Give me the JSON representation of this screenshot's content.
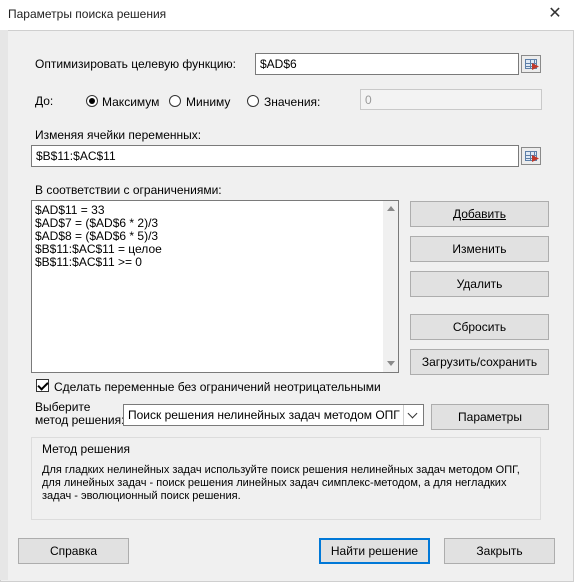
{
  "window": {
    "title": "Параметры поиска решения",
    "close_glyph": "✕"
  },
  "objective": {
    "label": "Оптимизировать целевую функцию:",
    "value": "$AD$6"
  },
  "goal": {
    "label": "До:",
    "options": [
      "Максимум",
      "Миниму",
      "Значения:"
    ],
    "selected": "Максимум",
    "value_field": "0"
  },
  "variables": {
    "label": "Изменяя ячейки переменных:",
    "value": "$B$11:$AC$11"
  },
  "constraints": {
    "label": "В соответствии с ограничениями:",
    "items": [
      "$AD$11 = 33",
      "$AD$7 = ($AD$6 * 2)/3",
      "$AD$8 = ($AD$6 * 5)/3",
      "$B$11:$AC$11 = целое",
      "$B$11:$AC$11 >= 0"
    ]
  },
  "buttons": {
    "add": "Добавить",
    "change": "Изменить",
    "delete": "Удалить",
    "reset": "Сбросить",
    "load_save": "Загрузить/сохранить",
    "parameters": "Параметры",
    "help": "Справка",
    "solve": "Найти решение",
    "close": "Закрыть"
  },
  "nonnegative": {
    "label": "Сделать переменные без ограничений неотрицательными",
    "checked": true
  },
  "method": {
    "label_line1": "Выберите",
    "label_line2": "метод решения:",
    "selected": "Поиск решения нелинейных задач методом ОПГ"
  },
  "method_group": {
    "title": "Метод решения",
    "description": "Для гладких нелинейных задач используйте поиск решения нелинейных задач методом ОПГ, для линейных задач - поиск решения линейных задач симплекс-методом, а для негладких задач - эволюционный поиск решения."
  },
  "icons": {
    "ref_button": "range-select-icon",
    "dropdown": "chevron-down-icon",
    "check": "checkmark-icon"
  }
}
